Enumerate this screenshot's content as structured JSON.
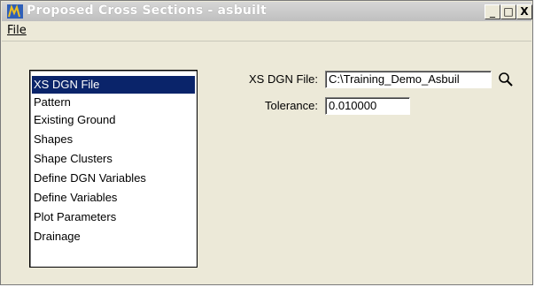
{
  "window": {
    "title": "Proposed Cross Sections - asbuilt",
    "controls": {
      "minimize": "_",
      "maximize": "□",
      "close": "X"
    }
  },
  "menu": {
    "file_label": "File"
  },
  "list": {
    "items": [
      {
        "label": "XS DGN File",
        "selected": true
      },
      {
        "label": "Pattern",
        "selected": false
      },
      {
        "label": "Existing Ground",
        "selected": false
      },
      {
        "label": "Shapes",
        "selected": false
      },
      {
        "label": "Shape Clusters",
        "selected": false
      },
      {
        "label": "Define DGN Variables",
        "selected": false
      },
      {
        "label": "Define Variables",
        "selected": false
      },
      {
        "label": "Plot Parameters",
        "selected": false
      },
      {
        "label": "Drainage",
        "selected": false
      }
    ]
  },
  "form": {
    "xs_dgn_file_label": "XS DGN File:",
    "xs_dgn_file_value": "C:\\Training_Demo_Asbuil",
    "tolerance_label": "Tolerance:",
    "tolerance_value": "0.010000"
  },
  "icons": {
    "app": "cross-section-app-icon",
    "search": "magnifier-icon"
  },
  "colors": {
    "selection": "#0a246a",
    "window_bg": "#ece9d8"
  }
}
